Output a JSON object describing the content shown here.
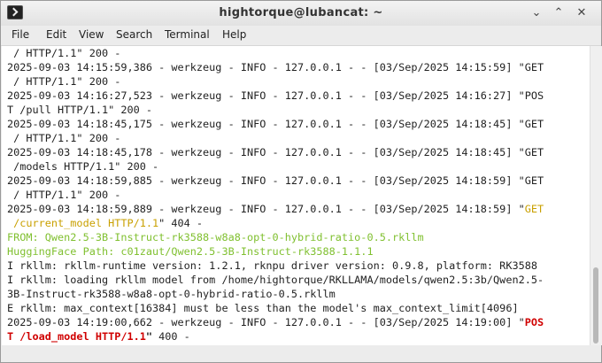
{
  "window": {
    "title": "hightorque@lubancat: ~",
    "minimize_glyph": "⌄",
    "maximize_glyph": "⌃",
    "close_glyph": "✕"
  },
  "menu": [
    "File",
    "Edit",
    "View",
    "Search",
    "Terminal",
    "Help"
  ],
  "terminal": {
    "lines": [
      " / HTTP/1.1\" 200 -",
      "2025-09-03 14:15:59,386 - werkzeug - INFO - 127.0.0.1 - - [03/Sep/2025 14:15:59] \"GET",
      " / HTTP/1.1\" 200 -",
      "2025-09-03 14:16:27,523 - werkzeug - INFO - 127.0.0.1 - - [03/Sep/2025 14:16:27] \"POS",
      "T /pull HTTP/1.1\" 200 -",
      "2025-09-03 14:18:45,175 - werkzeug - INFO - 127.0.0.1 - - [03/Sep/2025 14:18:45] \"GET",
      " / HTTP/1.1\" 200 -",
      "2025-09-03 14:18:45,178 - werkzeug - INFO - 127.0.0.1 - - [03/Sep/2025 14:18:45] \"GET",
      " /models HTTP/1.1\" 200 -",
      "2025-09-03 14:18:59,885 - werkzeug - INFO - 127.0.0.1 - - [03/Sep/2025 14:18:59] \"GET",
      " / HTTP/1.1\" 200 -"
    ],
    "l12_prefix": "2025-09-03 14:18:59,889 - werkzeug - INFO - 127.0.0.1 - - [03/Sep/2025 14:18:59] \"",
    "l12_colored": "GET",
    "l13_colored": " /current_model HTTP/1.1",
    "l13_suffix": "\" 404 -",
    "l14": "FROM: Qwen2.5-3B-Instruct-rk3588-w8a8-opt-0-hybrid-ratio-0.5.rkllm",
    "l15": "HuggingFace Path: c01zaut/Qwen2.5-3B-Instruct-rk3588-1.1.1",
    "l16": "I rkllm: rkllm-runtime version: 1.2.1, rknpu driver version: 0.9.8, platform: RK3588",
    "l17": "I rkllm: loading rkllm model from /home/hightorque/RKLLAMA/models/qwen2.5:3b/Qwen2.5-",
    "l18": "3B-Instruct-rk3588-w8a8-opt-0-hybrid-ratio-0.5.rkllm",
    "l19": "E rkllm: max_context[16384] must be less than the model's max_context_limit[4096]",
    "l20_prefix": "2025-09-03 14:19:00,662 - werkzeug - INFO - 127.0.0.1 - - [03/Sep/2025 14:19:00] \"",
    "l20_colored": "POS",
    "l21_colored": "T /load_model HTTP/1.1",
    "l21_quote": "\"",
    "l21_suffix": " 400 -",
    "colors": {
      "amber": "#c9a000",
      "green": "#80c030",
      "red": "#d00000"
    }
  }
}
